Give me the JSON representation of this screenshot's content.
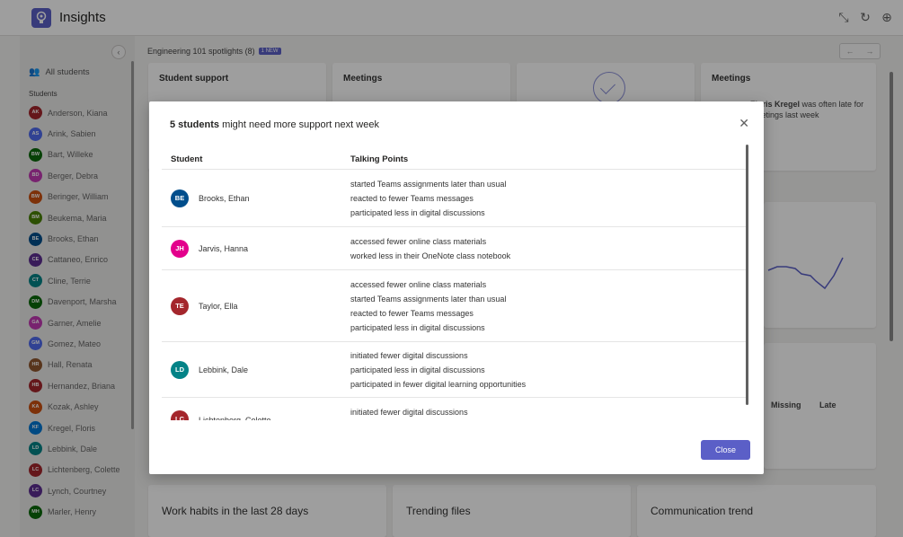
{
  "app": {
    "title": "Insights"
  },
  "window_icons": [
    "minimize-arrows-icon",
    "refresh-icon",
    "globe-icon"
  ],
  "sidebar": {
    "all_students": "All students",
    "section_label": "Students",
    "students": [
      {
        "name": "Anderson, Kiana",
        "initials": "AK",
        "color": "#a4262c"
      },
      {
        "name": "Arink, Sabien",
        "initials": "AS",
        "color": "#4f6bed"
      },
      {
        "name": "Bart, Willeke",
        "initials": "BW",
        "color": "#0b6a0b"
      },
      {
        "name": "Berger, Debra",
        "initials": "BD",
        "color": "#c239b3"
      },
      {
        "name": "Beringer, William",
        "initials": "BW",
        "color": "#ca5010"
      },
      {
        "name": "Beukema, Maria",
        "initials": "BM",
        "color": "#498205"
      },
      {
        "name": "Brooks, Ethan",
        "initials": "BE",
        "color": "#004e8c"
      },
      {
        "name": "Cattaneo, Enrico",
        "initials": "CE",
        "color": "#5c2e91"
      },
      {
        "name": "Cline, Terrie",
        "initials": "CT",
        "color": "#038387"
      },
      {
        "name": "Davenport, Marsha",
        "initials": "DM",
        "color": "#0b6a0b"
      },
      {
        "name": "Garner, Amelie",
        "initials": "GA",
        "color": "#c239b3"
      },
      {
        "name": "Gomez, Mateo",
        "initials": "GM",
        "color": "#4f6bed"
      },
      {
        "name": "Hall, Renata",
        "initials": "HR",
        "color": "#8e562e"
      },
      {
        "name": "Hernandez, Briana",
        "initials": "HB",
        "color": "#a4262c"
      },
      {
        "name": "Kozak, Ashley",
        "initials": "KA",
        "color": "#ca5010"
      },
      {
        "name": "Kregel, Floris",
        "initials": "KF",
        "color": "#0078d4"
      },
      {
        "name": "Lebbink, Dale",
        "initials": "LD",
        "color": "#038387"
      },
      {
        "name": "Lichtenberg, Colette",
        "initials": "LC",
        "color": "#a4262c"
      },
      {
        "name": "Lynch, Courtney",
        "initials": "LC",
        "color": "#5c2e91"
      },
      {
        "name": "Marler, Henry",
        "initials": "MH",
        "color": "#0b6a0b"
      }
    ]
  },
  "spotlights": {
    "header": "Engineering 101 spotlights (8)",
    "badge": "1 NEW",
    "cards": [
      {
        "title": "Student support"
      },
      {
        "title": "Meetings"
      },
      {
        "title": ""
      },
      {
        "title": "Meetings",
        "text_bold": "Floris Kregel",
        "text": "was often late for meetings last week"
      }
    ]
  },
  "background_cards": {
    "missing": "Missing",
    "late": "Late",
    "work_habits": "Work habits in the last 28 days",
    "trending_files": "Trending files",
    "communication_trend": "Communication trend"
  },
  "modal": {
    "title_bold": "5 students",
    "title_rest": " might need more support next week",
    "col_student": "Student",
    "col_points": "Talking Points",
    "close_label": "Close",
    "rows": [
      {
        "name": "Brooks, Ethan",
        "initials": "BE",
        "color": "#004e8c",
        "p0": "started Teams assignments later than usual",
        "p1": "reacted to fewer Teams messages",
        "p2": "participated less in digital discussions",
        "p3": ""
      },
      {
        "name": "Jarvis, Hanna",
        "initials": "JH",
        "color": "#e3008c",
        "p0": "accessed fewer online class materials",
        "p1": "worked less in their OneNote class notebook",
        "p2": "",
        "p3": ""
      },
      {
        "name": "Taylor, Ella",
        "initials": "TE",
        "color": "#a4262c",
        "p0": "accessed fewer online class materials",
        "p1": "started Teams assignments later than usual",
        "p2": "reacted to fewer Teams messages",
        "p3": "participated less in digital discussions"
      },
      {
        "name": "Lebbink, Dale",
        "initials": "LD",
        "color": "#038387",
        "p0": "initiated fewer digital discussions",
        "p1": "participated less in digital discussions",
        "p2": "participated in fewer digital learning opportunities",
        "p3": ""
      },
      {
        "name": "Lichtenberg, Colette",
        "initials": "LC",
        "color": "#a4262c",
        "p0": "initiated fewer digital discussions",
        "p1": "",
        "p2": "",
        "p3": ""
      }
    ]
  }
}
